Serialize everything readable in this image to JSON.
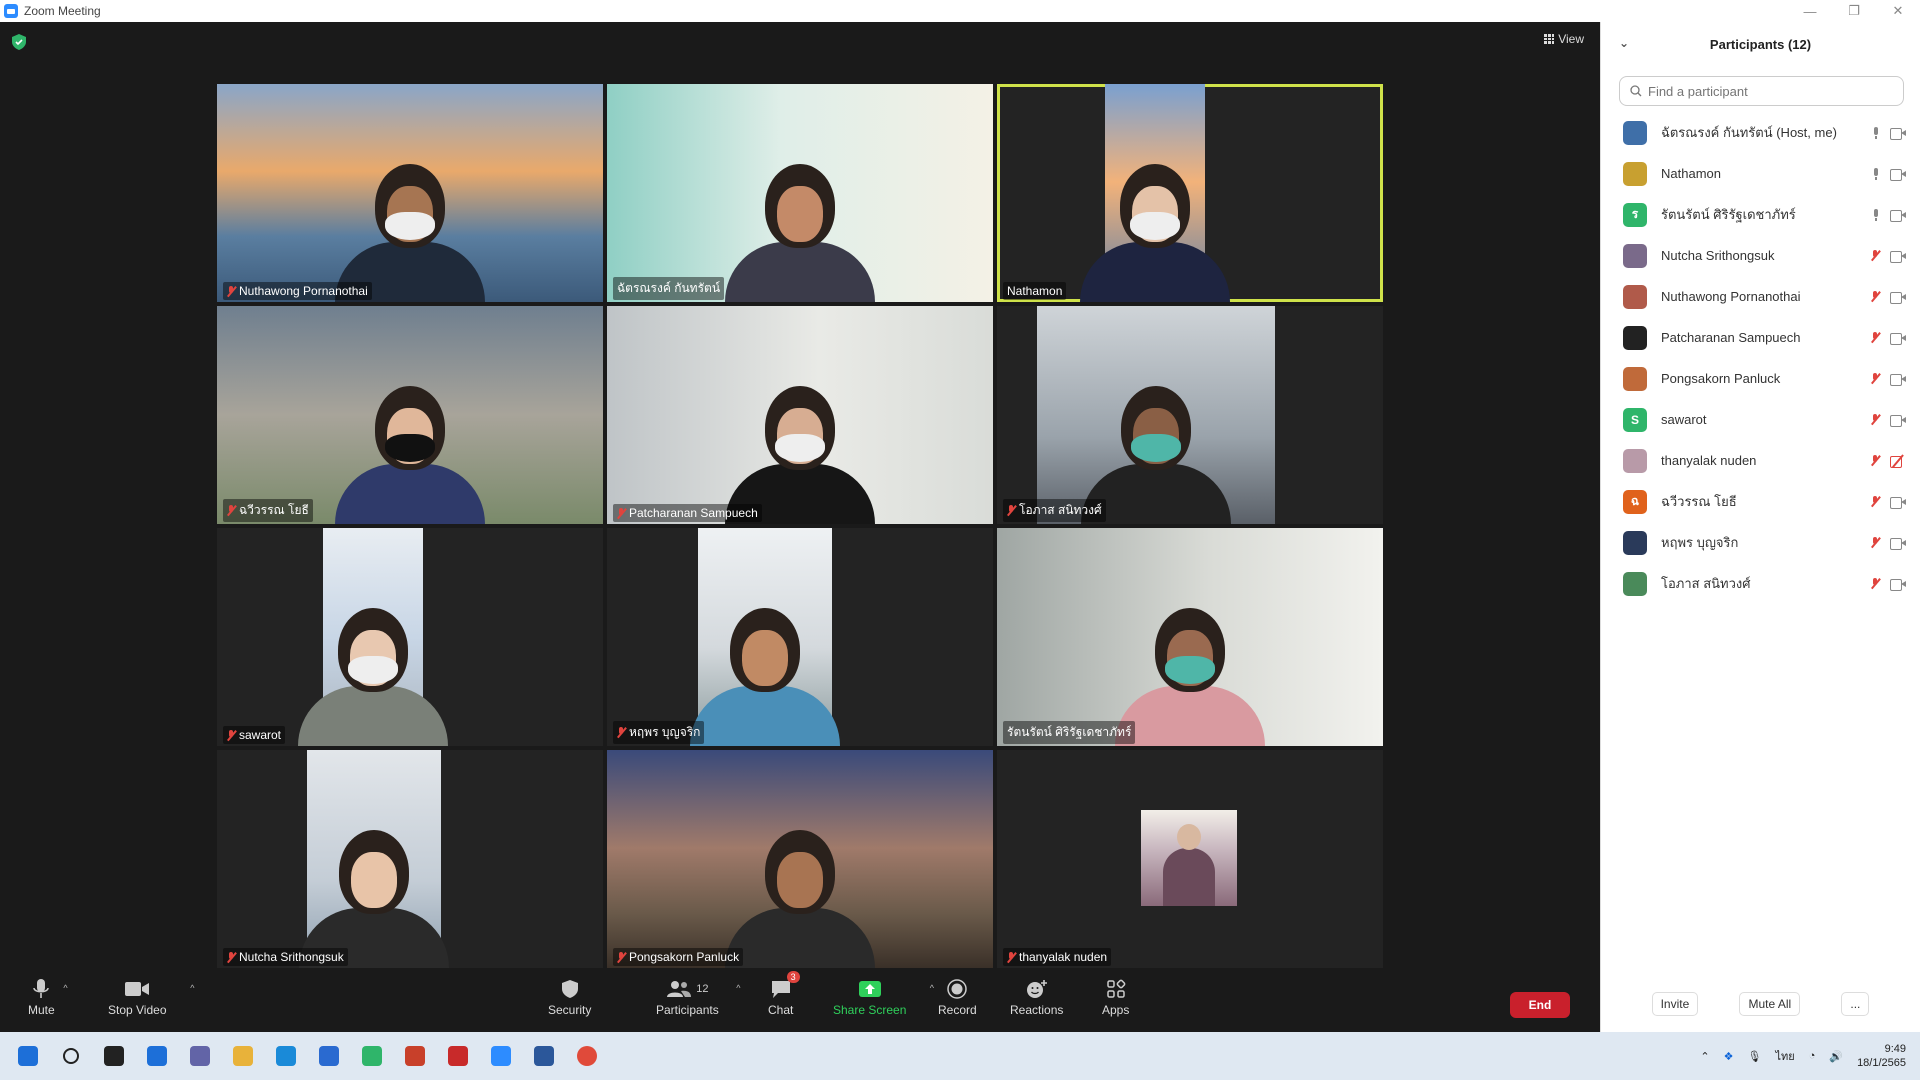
{
  "window": {
    "title": "Zoom Meeting"
  },
  "toolbar": {
    "view_label": "View"
  },
  "tiles": [
    {
      "name": "Nuthawong Pornanothai",
      "muted": true,
      "active": false,
      "bg": "linear-gradient(180deg,#8aa6c8 0%,#e9a96b 40%,#5a7ea0 70%,#3c5a7a 100%)",
      "skin": "#a67552",
      "mask": "white",
      "shirt": "#1f2a3a"
    },
    {
      "name": "ฉัตรณรงค์ กันทรัตน์",
      "muted": false,
      "active": false,
      "bg": "linear-gradient(90deg,#8fcfc4 0%,#dfeee8 45%,#f4f1e6 100%)",
      "skin": "#c48a68",
      "mask": "none",
      "shirt": "#3b3b4a"
    },
    {
      "name": "Nathamon",
      "muted": false,
      "active": true,
      "bg": "linear-gradient(180deg,#7aa0d0 0%,#f2b27a 45%,#5d7fa8 100%)",
      "skin": "#e4c2a8",
      "mask": "white",
      "shirt": "#1e2440"
    },
    {
      "name": "ฉวีวรรณ โยธี",
      "muted": true,
      "active": false,
      "bg": "linear-gradient(180deg,#6f7f8f 0%,#a8a49a 50%,#7a8a6a 100%)",
      "skin": "#e0b79a",
      "mask": "black",
      "shirt": "#2f3a6a"
    },
    {
      "name": "Patcharanan Sampuech",
      "muted": true,
      "active": false,
      "bg": "linear-gradient(90deg,#bfc4c7 0%,#e9eae6 55%,#d9dcd8 100%)",
      "skin": "#d7ad92",
      "mask": "white",
      "shirt": "#161616"
    },
    {
      "name": "โอภาส สนิทวงศ์",
      "muted": true,
      "active": false,
      "bg": "linear-gradient(180deg,#cfd4d8 0%,#9aa3ab 60%,#5a6068 100%)",
      "skin": "#8a5f45",
      "mask": "teal",
      "shirt": "#222"
    },
    {
      "name": "sawarot",
      "muted": true,
      "active": false,
      "bg": "linear-gradient(180deg,#e8edf2 0%,#c8d6e6 50%,#aab4be 100%)",
      "skin": "#e8c8b0",
      "mask": "white",
      "shirt": "#7a8078"
    },
    {
      "name": "หฤพร บุญจริก",
      "muted": true,
      "active": false,
      "bg": "linear-gradient(180deg,#eef1f3 0%,#d4d9dd 55%,#8a9a9c 100%)",
      "skin": "#c18a64",
      "mask": "none",
      "shirt": "#4a8fb8"
    },
    {
      "name": "รัตนรัตน์ ศิริรัฐเดชาภัทร์",
      "muted": false,
      "active": false,
      "bg": "linear-gradient(90deg,#9fa6a3 0%,#d9dbd6 55%,#f2f2ee 100%)",
      "skin": "#9a6a50",
      "mask": "teal",
      "shirt": "#d99aa0"
    },
    {
      "name": "Nutcha Srithongsuk",
      "muted": true,
      "active": false,
      "bg": "linear-gradient(180deg,#e2e6ea 0%,#c4cdd6 60%,#8fa0b0 100%)",
      "skin": "#e8c4a8",
      "mask": "none",
      "shirt": "#2a2a2a"
    },
    {
      "name": "Pongsakorn Panluck",
      "muted": true,
      "active": false,
      "bg": "linear-gradient(180deg,#3a4a7a 0%,#a07a6a 45%,#6a5a4a 75%,#3a3028 100%)",
      "skin": "#a87452",
      "mask": "none",
      "shirt": "#2a2a2a"
    },
    {
      "name": "thanyalak nuden",
      "muted": true,
      "active": false,
      "bg": "none",
      "skin": "#d8b8a0",
      "mask": "none",
      "shirt": "#6a4a5a"
    }
  ],
  "controls": {
    "mute": "Mute",
    "stop_video": "Stop Video",
    "security": "Security",
    "participants": "Participants",
    "participants_count": "12",
    "chat": "Chat",
    "chat_badge": "3",
    "share_screen": "Share Screen",
    "record": "Record",
    "reactions": "Reactions",
    "apps": "Apps",
    "end": "End"
  },
  "panel": {
    "title": "Participants (12)",
    "search_placeholder": "Find a participant",
    "participants": [
      {
        "name": "ฉัตรณรงค์ กันทรัตน์ (Host, me)",
        "initial": "",
        "color": "#3f6fa8",
        "mic": "on",
        "cam": "on"
      },
      {
        "name": "Nathamon",
        "initial": "",
        "color": "#c8a030",
        "mic": "on",
        "cam": "on"
      },
      {
        "name": "รัตนรัตน์ ศิริรัฐเดชาภัทร์",
        "initial": "ร",
        "color": "#2fb56a",
        "mic": "on",
        "cam": "on"
      },
      {
        "name": "Nutcha Srithongsuk",
        "initial": "",
        "color": "#7a6a8a",
        "mic": "off",
        "cam": "on"
      },
      {
        "name": "Nuthawong Pornanothai",
        "initial": "",
        "color": "#b05a4a",
        "mic": "off",
        "cam": "on"
      },
      {
        "name": "Patcharanan Sampuech",
        "initial": "",
        "color": "#222222",
        "mic": "off",
        "cam": "on"
      },
      {
        "name": "Pongsakorn Panluck",
        "initial": "",
        "color": "#c06a3a",
        "mic": "off",
        "cam": "on"
      },
      {
        "name": "sawarot",
        "initial": "S",
        "color": "#2fb56a",
        "mic": "off",
        "cam": "on"
      },
      {
        "name": "thanyalak nuden",
        "initial": "",
        "color": "#b89aa8",
        "mic": "off",
        "cam": "off"
      },
      {
        "name": "ฉวีวรรณ โยธี",
        "initial": "ฉ",
        "color": "#e0621c",
        "mic": "off",
        "cam": "on"
      },
      {
        "name": "หฤพร บุญจริก",
        "initial": "",
        "color": "#2a3a5a",
        "mic": "off",
        "cam": "on"
      },
      {
        "name": "โอภาส สนิทวงศ์",
        "initial": "",
        "color": "#4a8a5a",
        "mic": "off",
        "cam": "on"
      }
    ],
    "invite": "Invite",
    "mute_all": "Mute All",
    "more": "..."
  },
  "taskbar": {
    "lang": "ไทย",
    "time": "9:49",
    "date": "18/1/2565",
    "apps": [
      "start-icon",
      "search-icon",
      "task-view-icon",
      "widgets-icon",
      "teams-chat-icon",
      "file-explorer-icon",
      "edge-icon",
      "store-icon",
      "line-icon",
      "powerpoint-icon",
      "acrobat-icon",
      "zoom-icon",
      "word-icon",
      "chrome-icon"
    ]
  }
}
